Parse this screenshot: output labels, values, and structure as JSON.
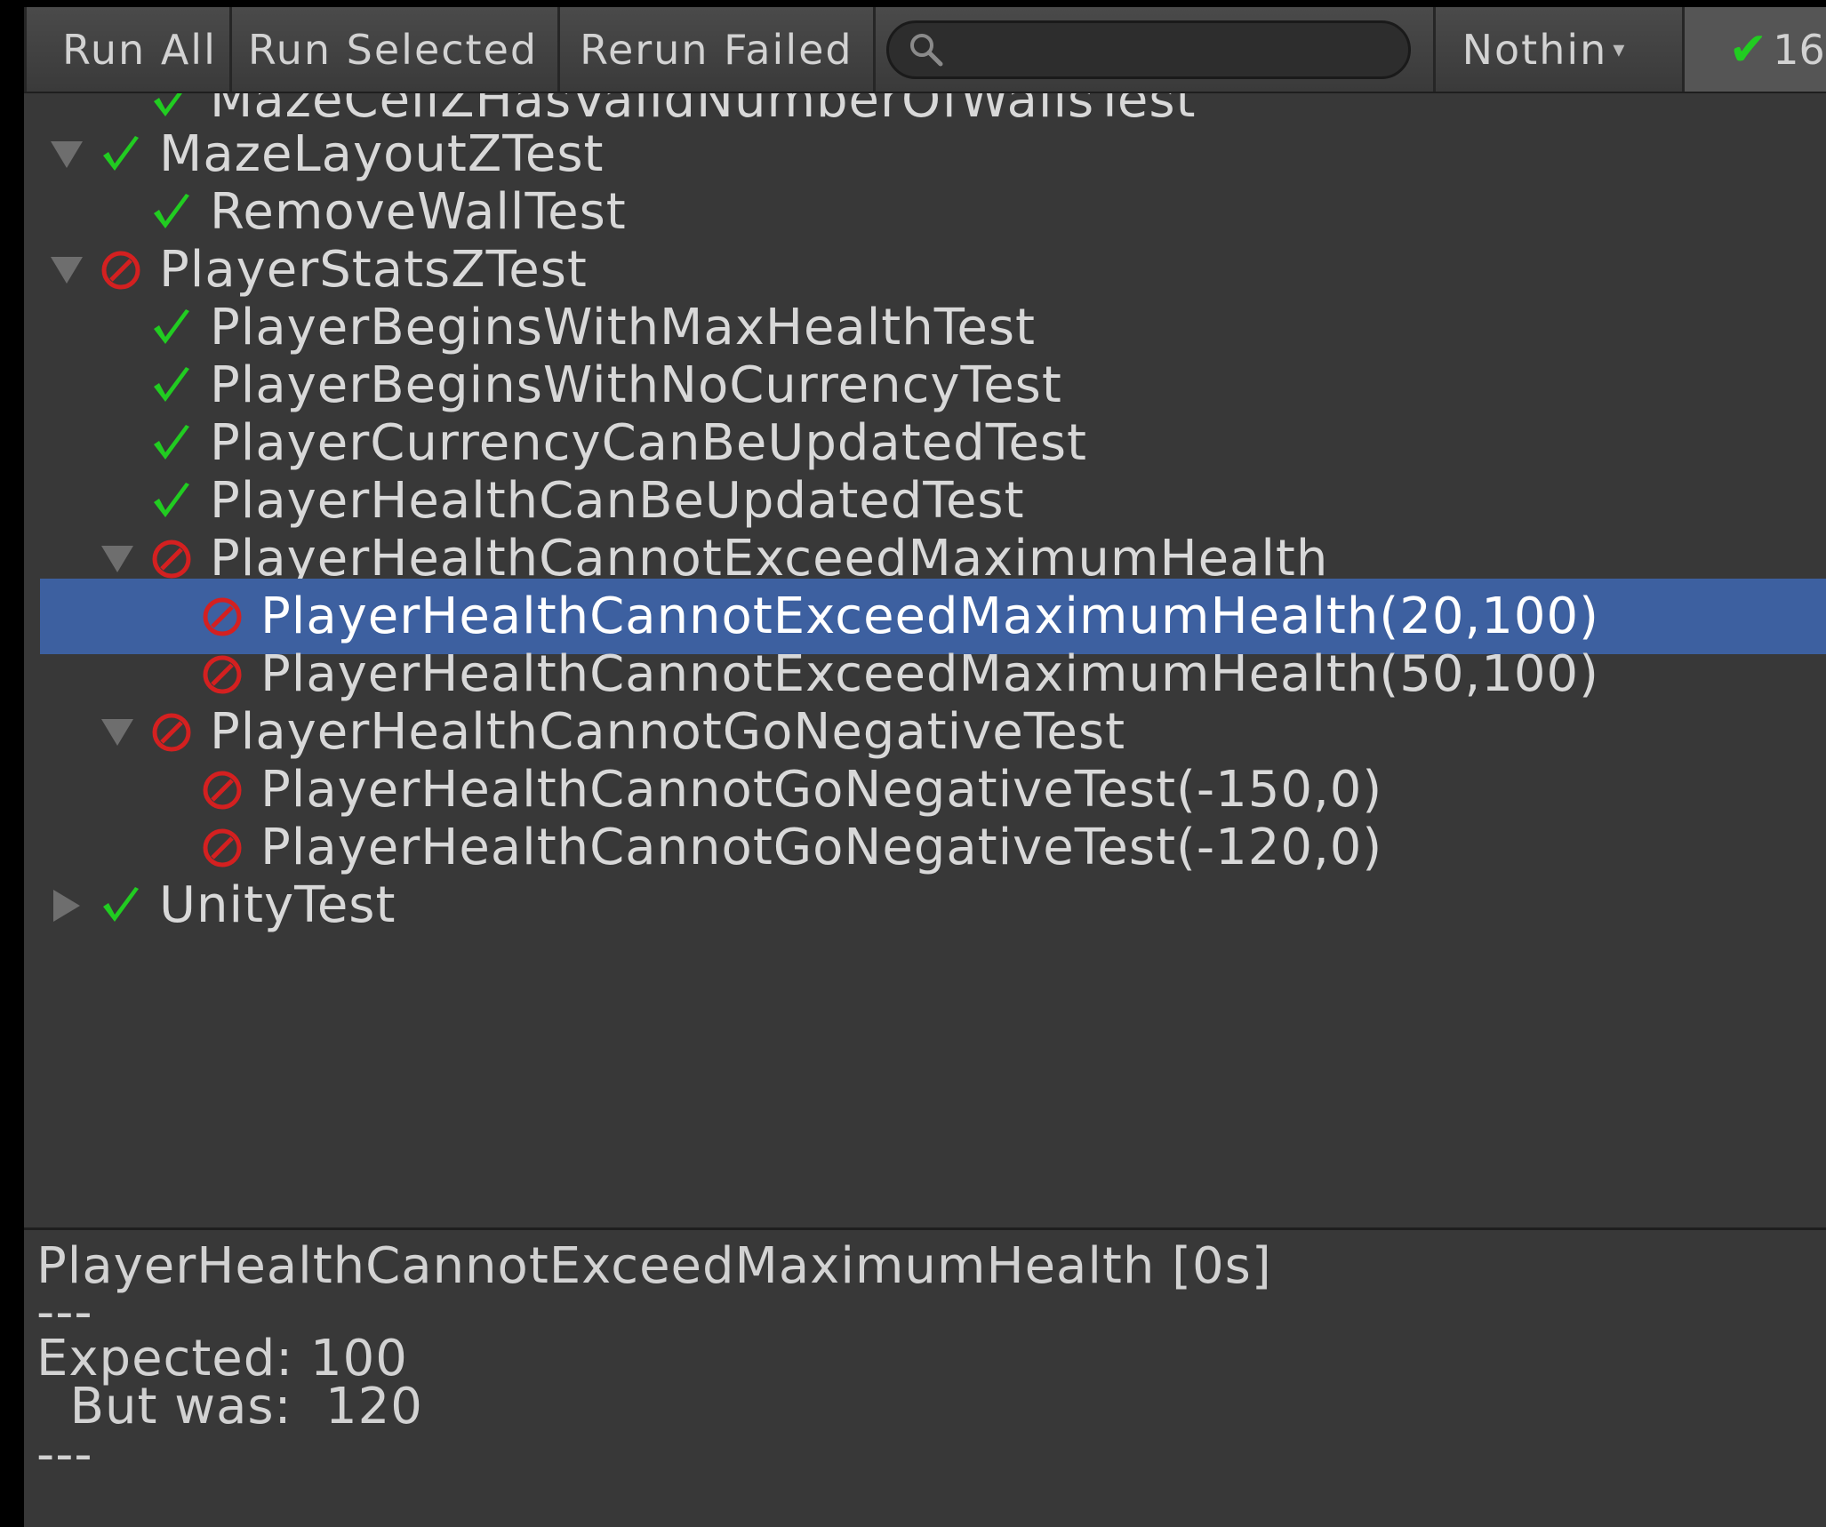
{
  "toolbar": {
    "run_all": "Run All",
    "run_selected": "Run Selected",
    "rerun_failed": "Rerun Failed",
    "search_value": "",
    "filter_label": "Nothin",
    "passed_count": "16"
  },
  "tree": {
    "rows": [
      {
        "label": "MazeCellZHasValidNumberOfWallsTest",
        "status": "pass"
      },
      {
        "label": "MazeLayoutZTest",
        "status": "pass",
        "expander": "expanded"
      },
      {
        "label": "RemoveWallTest",
        "status": "pass"
      },
      {
        "label": "PlayerStatsZTest",
        "status": "fail",
        "expander": "expanded"
      },
      {
        "label": "PlayerBeginsWithMaxHealthTest",
        "status": "pass"
      },
      {
        "label": "PlayerBeginsWithNoCurrencyTest",
        "status": "pass"
      },
      {
        "label": "PlayerCurrencyCanBeUpdatedTest",
        "status": "pass"
      },
      {
        "label": "PlayerHealthCanBeUpdatedTest",
        "status": "pass"
      },
      {
        "label": "PlayerHealthCannotExceedMaximumHealth",
        "status": "fail",
        "expander": "expanded"
      },
      {
        "label": "PlayerHealthCannotExceedMaximumHealth(20,100)",
        "status": "fail",
        "selected": true
      },
      {
        "label": "PlayerHealthCannotExceedMaximumHealth(50,100)",
        "status": "fail"
      },
      {
        "label": "PlayerHealthCannotGoNegativeTest",
        "status": "fail",
        "expander": "expanded"
      },
      {
        "label": "PlayerHealthCannotGoNegativeTest(-150,0)",
        "status": "fail"
      },
      {
        "label": "PlayerHealthCannotGoNegativeTest(-120,0)",
        "status": "fail"
      },
      {
        "label": "UnityTest",
        "status": "pass",
        "expander": "collapsed"
      }
    ]
  },
  "details": {
    "title": "PlayerHealthCannotExceedMaximumHealth [0s]",
    "separator1": "---",
    "expected": "Expected: 100",
    "but_was": "  But was:  120",
    "separator2": "---"
  },
  "colors": {
    "pass": "#21cc21",
    "fail": "#d42020",
    "selection": "#3d60a0",
    "background": "#383838"
  }
}
